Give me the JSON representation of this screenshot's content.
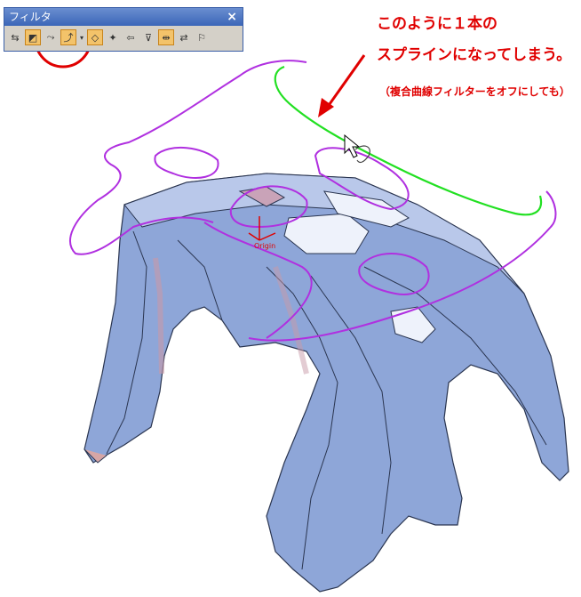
{
  "toolbar": {
    "title": "フィルタ",
    "close_glyph": "×",
    "buttons": [
      {
        "name": "filter-swap-icon",
        "glyph": "⇆",
        "active": false
      },
      {
        "name": "filter-edge-icon",
        "glyph": "◩",
        "active": true
      },
      {
        "name": "filter-curve-icon",
        "glyph": "⤳",
        "active": false
      },
      {
        "name": "filter-composite-curve-icon",
        "glyph": "⤴",
        "active": true
      },
      {
        "name": "dropdown-arrow-icon",
        "glyph": "▾",
        "active": false
      },
      {
        "name": "filter-face-icon",
        "glyph": "◇",
        "active": true
      },
      {
        "name": "filter-vertex-icon",
        "glyph": "✦",
        "active": false
      },
      {
        "name": "filter-point-icon",
        "glyph": "⇦",
        "active": false
      },
      {
        "name": "filter-body-icon",
        "glyph": "⊽",
        "active": false
      },
      {
        "name": "filter-select-all-icon",
        "glyph": "⇹",
        "active": true
      },
      {
        "name": "filter-clear-icon",
        "glyph": "⇄",
        "active": false
      },
      {
        "name": "filter-settings-icon",
        "glyph": "⚐",
        "active": false
      }
    ]
  },
  "annotation": {
    "line1": "このように１本の",
    "line2": "スプラインになってしまう。",
    "note": "（複合曲線フィルターをオフにしても）"
  },
  "origin_label": "Origin",
  "colors": {
    "annotation": "#e00000",
    "spline_selected": "#22e022",
    "spline_magenta": "#b030e0",
    "part_fill": "#8ea6d8"
  }
}
